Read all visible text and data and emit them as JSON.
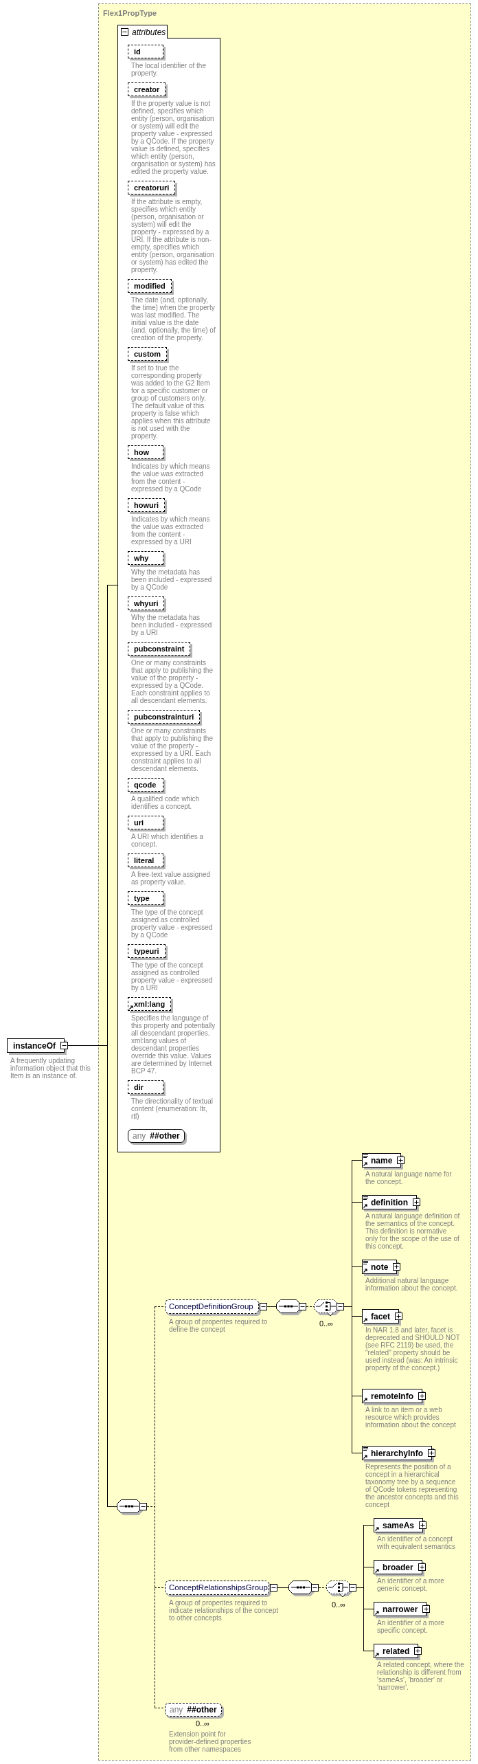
{
  "type_panel": {
    "title": "Flex1PropType"
  },
  "attributes": {
    "title": "attributes",
    "expanded": true,
    "items": [
      {
        "name": "id",
        "description": "The local identifier of the property.",
        "optional": true,
        "reference": false
      },
      {
        "name": "creator",
        "description": "If the property value is not defined, specifies which entity (person, organisation or system) will edit the property value - expressed by a QCode. If the property value is defined, specifies which entity (person, organisation or system) has edited the property value.",
        "optional": true,
        "reference": false
      },
      {
        "name": "creatoruri",
        "description": "If the attribute is empty, specifies which entity (person, organisation or system) will edit the property - expressed by a URI. If the attribute is non-empty, specifies which entity (person, organisation or system) has edited the property.",
        "optional": true,
        "reference": false
      },
      {
        "name": "modified",
        "description": "The date (and, optionally, the time) when the property was last modified. The initial value is the date (and, optionally, the time) of creation of the property.",
        "optional": true,
        "reference": false
      },
      {
        "name": "custom",
        "description": "If set to true the corresponding property was added to the G2 Item for a specific customer or group of customers only. The default value of this property is false which applies when this attribute is not used with the property.",
        "optional": true,
        "reference": false
      },
      {
        "name": "how",
        "description": "Indicates by which means the value was extracted from the content - expressed by a QCode",
        "optional": true,
        "reference": false
      },
      {
        "name": "howuri",
        "description": "Indicates by which means the value was extracted from the content - expressed by a URI",
        "optional": true,
        "reference": false
      },
      {
        "name": "why",
        "description": "Why the metadata has been included - expressed by a QCode",
        "optional": true,
        "reference": false
      },
      {
        "name": "whyuri",
        "description": "Why the metadata has been included - expressed by a URI",
        "optional": true,
        "reference": false
      },
      {
        "name": "pubconstraint",
        "description": "One or many constraints that apply to publishing the value of the property - expressed by a QCode. Each constraint applies to all descendant elements.",
        "optional": true,
        "reference": false
      },
      {
        "name": "pubconstrainturi",
        "description": "One or many constraints that apply to publishing the value of the property - expressed by a URI. Each constraint applies to all descendant elements.",
        "optional": true,
        "reference": false
      },
      {
        "name": "qcode",
        "description": "A qualified code which identifies a concept.",
        "optional": true,
        "reference": false
      },
      {
        "name": "uri",
        "description": "A URI which identifies a concept.",
        "optional": true,
        "reference": false
      },
      {
        "name": "literal",
        "description": "A free-text value assigned as property value.",
        "optional": true,
        "reference": false
      },
      {
        "name": "type",
        "description": "The type of the concept assigned as controlled property value - expressed by a QCode",
        "optional": true,
        "reference": false
      },
      {
        "name": "typeuri",
        "description": "The type of the concept assigned as controlled property value - expressed by a URI",
        "optional": true,
        "reference": false
      },
      {
        "name": "xml:lang",
        "description": "Specifies the language of this property and potentially all descendant properties. xml:lang values of descendant properties override this value. Values are determined by Internet BCP 47.",
        "optional": true,
        "reference": true
      },
      {
        "name": "dir",
        "description": "The directionality of textual content (enumeration: ltr, rtl)",
        "optional": true,
        "reference": false
      }
    ],
    "wildcard": {
      "label": "any",
      "namespace": "##other",
      "optional": false
    }
  },
  "root_element": {
    "name": "instanceOf",
    "description": "A frequently updating information object that this Item is an instance of.",
    "expanded": true
  },
  "content_model": {
    "expanded": true
  },
  "groups": [
    {
      "name": "ConceptDefinitionGroup",
      "description": "A group of properites required to define the concept",
      "optional": true,
      "expanded": true,
      "sequence_expanded": true,
      "choice": {
        "expanded": true,
        "occurrence": "0..∞"
      },
      "elements": [
        {
          "name": "name",
          "description": "A natural language name for the concept.",
          "content_icon": true,
          "reference": true,
          "expanded": false
        },
        {
          "name": "definition",
          "description": "A natural language definition of the semantics of the concept. This definition is normative only for the scope of the use of this concept.",
          "content_icon": true,
          "reference": true,
          "expanded": false
        },
        {
          "name": "note",
          "description": "Additional natural language information about the concept.",
          "content_icon": true,
          "reference": true,
          "expanded": false
        },
        {
          "name": "facet",
          "description": "In NAR 1.8 and later, facet is deprecated and SHOULD NOT (see RFC 2119) be used, the \"related\" property should be used instead (was: An intrinsic property of the concept.)",
          "content_icon": false,
          "reference": true,
          "expanded": false
        },
        {
          "name": "remoteInfo",
          "description": "A link to an item or a web resource which provides information about the concept",
          "content_icon": false,
          "reference": true,
          "expanded": false
        },
        {
          "name": "hierarchyInfo",
          "description": "Represents the position of a concept in a hierarchical taxonomy tree by a sequence of QCode tokens representing the ancestor concepts and this concept",
          "content_icon": true,
          "reference": true,
          "expanded": false
        }
      ]
    },
    {
      "name": "ConceptRelationshipsGroup",
      "description": "A group of properites required to indicate relationships of the concept to other concepts",
      "optional": true,
      "expanded": true,
      "sequence_expanded": true,
      "choice": {
        "expanded": true,
        "occurrence": "0..∞"
      },
      "elements": [
        {
          "name": "sameAs",
          "description": "An identifier of a concept with equivalent semantics",
          "content_icon": false,
          "reference": true,
          "expanded": false
        },
        {
          "name": "broader",
          "description": "An identifier of a more generic concept.",
          "content_icon": false,
          "reference": true,
          "expanded": false
        },
        {
          "name": "narrower",
          "description": "An identifier of a more specific concept.",
          "content_icon": false,
          "reference": true,
          "expanded": false
        },
        {
          "name": "related",
          "description": "A related concept, where the relationship is different from 'sameAs', 'broader' or 'narrower'.",
          "content_icon": false,
          "reference": true,
          "expanded": false
        }
      ]
    }
  ],
  "any_element": {
    "label": "any",
    "namespace": "##other",
    "optional": true,
    "occurrence": "0..∞",
    "description": "Extension point for provider-defined properties from other namespaces"
  }
}
